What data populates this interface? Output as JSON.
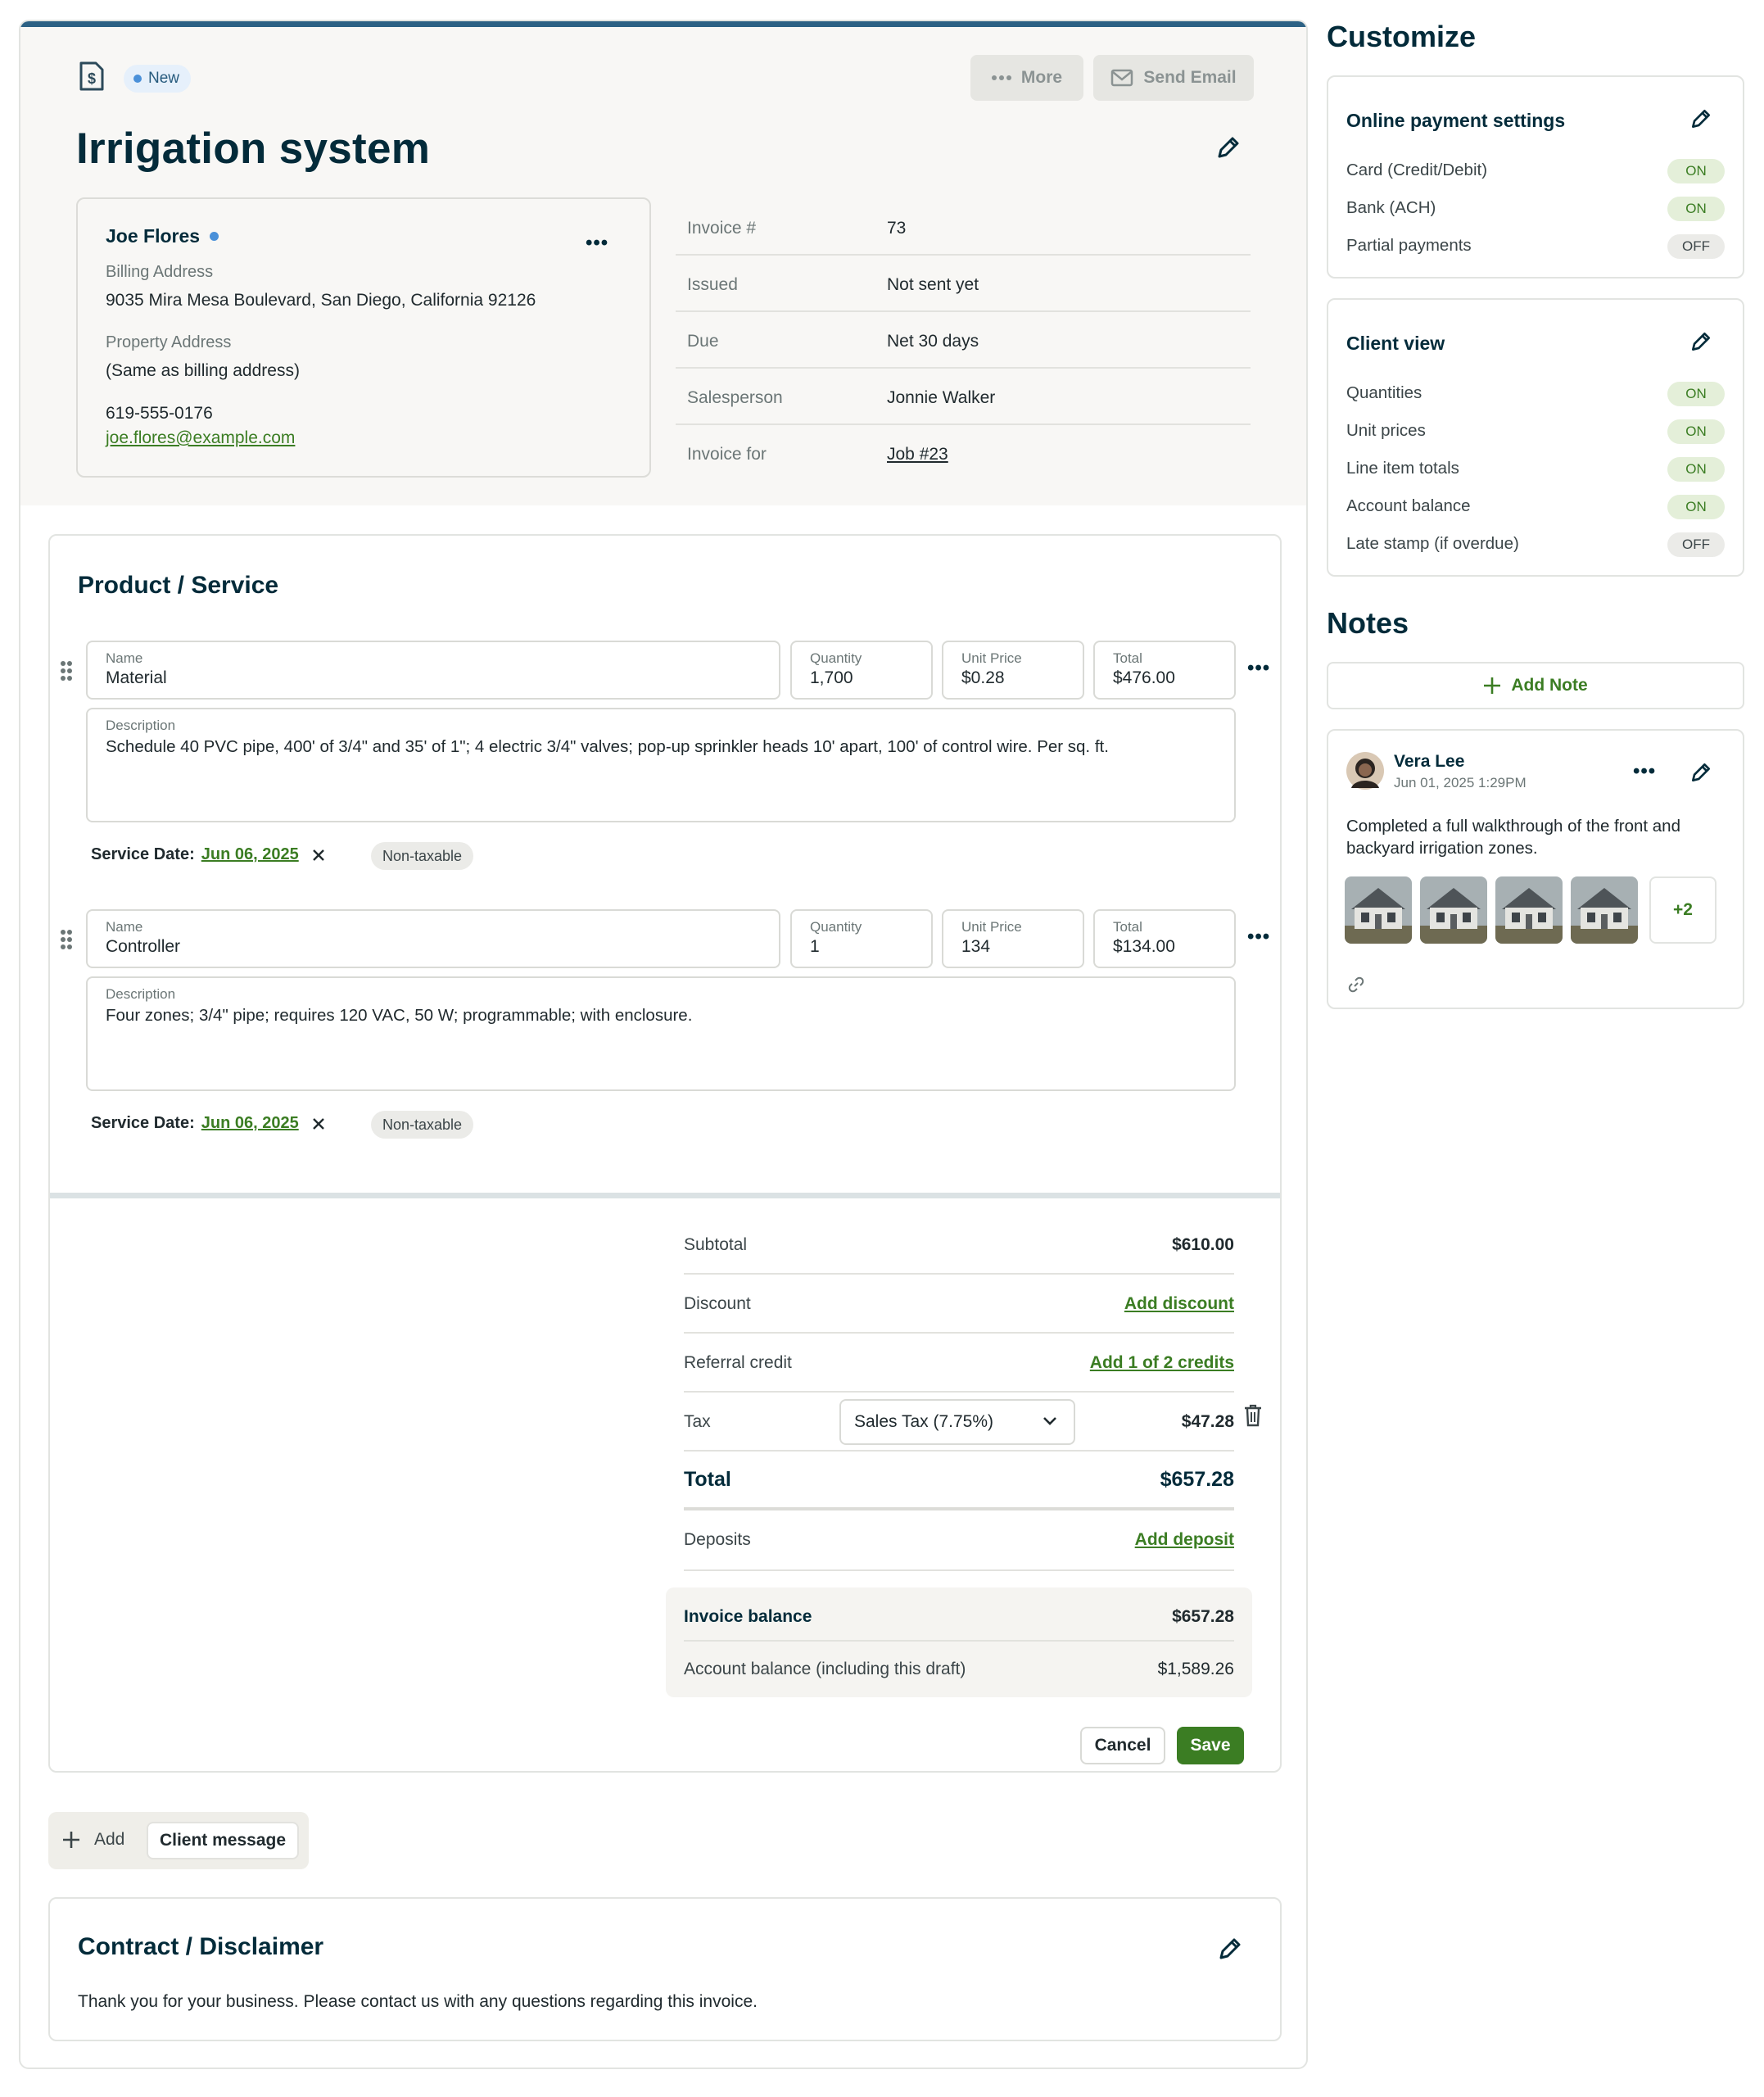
{
  "invoice": {
    "status": "New",
    "more_label": "More",
    "send_email_label": "Send Email",
    "title": "Irrigation system"
  },
  "client": {
    "name": "Joe Flores",
    "billing_label": "Billing Address",
    "billing_address": "9035 Mira Mesa Boulevard, San Diego, California 92126",
    "property_label": "Property Address",
    "property_address": "(Same as billing address)",
    "phone": "619-555-0176",
    "email": "joe.flores@example.com"
  },
  "meta": [
    {
      "label": "Invoice #",
      "value": "73"
    },
    {
      "label": "Issued",
      "value": "Not sent yet"
    },
    {
      "label": "Due",
      "value": "Net 30 days"
    },
    {
      "label": "Salesperson",
      "value": "Jonnie Walker"
    },
    {
      "label": "Invoice for",
      "value": "Job #23"
    }
  ],
  "products": {
    "title": "Product / Service",
    "labels": {
      "name": "Name",
      "quantity": "Quantity",
      "unit_price": "Unit Price",
      "total": "Total",
      "description": "Description",
      "service_date": "Service Date:"
    },
    "items": [
      {
        "name": "Material",
        "quantity": "1,700",
        "unit_price": "$0.28",
        "total": "$476.00",
        "description": "Schedule 40 PVC pipe, 400' of 3/4\" and 35' of 1\"; 4 electric 3/4\" valves; pop-up sprinkler heads 10' apart, 100' of control wire. Per sq. ft.",
        "service_date": "Jun 06, 2025",
        "tax_tag": "Non-taxable"
      },
      {
        "name": "Controller",
        "quantity": "1",
        "unit_price": "134",
        "total": "$134.00",
        "description": "Four zones; 3/4\" pipe; requires 120 VAC, 50 W; programmable; with enclosure.",
        "service_date": "Jun 06, 2025",
        "tax_tag": "Non-taxable"
      }
    ]
  },
  "totals": {
    "subtotal_label": "Subtotal",
    "subtotal": "$610.00",
    "discount_label": "Discount",
    "discount_action": "Add discount",
    "referral_label": "Referral credit",
    "referral_action": "Add 1 of 2 credits",
    "tax_label": "Tax",
    "tax_select": "Sales Tax (7.75%)",
    "tax": "$47.28",
    "total_label": "Total",
    "total": "$657.28",
    "deposits_label": "Deposits",
    "deposits_action": "Add deposit",
    "invoice_balance_label": "Invoice balance",
    "invoice_balance": "$657.28",
    "account_balance_label": "Account balance (including this draft)",
    "account_balance": "$1,589.26"
  },
  "actions": {
    "cancel": "Cancel",
    "save": "Save"
  },
  "add_bar": {
    "add_label": "Add",
    "chip": "Client message"
  },
  "contract": {
    "title": "Contract / Disclaimer",
    "text": "Thank you for your business. Please contact us with any questions regarding this invoice."
  },
  "customize": {
    "title": "Customize",
    "payment": {
      "title": "Online payment settings",
      "options": [
        {
          "label": "Card (Credit/Debit)",
          "state": "ON"
        },
        {
          "label": "Bank (ACH)",
          "state": "ON"
        },
        {
          "label": "Partial payments",
          "state": "OFF"
        }
      ]
    },
    "client_view": {
      "title": "Client view",
      "options": [
        {
          "label": "Quantities",
          "state": "ON"
        },
        {
          "label": "Unit prices",
          "state": "ON"
        },
        {
          "label": "Line item totals",
          "state": "ON"
        },
        {
          "label": "Account balance",
          "state": "ON"
        },
        {
          "label": "Late stamp (if overdue)",
          "state": "OFF"
        }
      ]
    }
  },
  "notes": {
    "title": "Notes",
    "add_label": "Add Note",
    "note": {
      "author": "Vera Lee",
      "timestamp": "Jun 01, 2025 1:29PM",
      "text": "Completed a full walkthrough of the front and backyard irrigation zones.",
      "more_photos": "+2"
    }
  },
  "colors": {
    "brand_green": "#3b7d23",
    "navy": "#032b3a",
    "top_accent": "#2c6184"
  }
}
